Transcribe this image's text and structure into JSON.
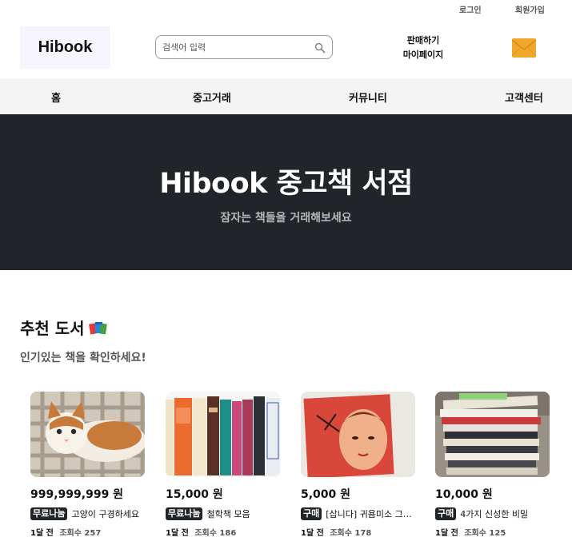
{
  "header": {
    "login": "로그인",
    "signup": "회원가입",
    "logo": "Hibook",
    "search_placeholder": "검색어 입력",
    "sell": "판매하기",
    "mypage": "마이페이지",
    "icons": {
      "search": "magnifier-icon",
      "mail": "envelope-icon"
    }
  },
  "nav": {
    "home": "홈",
    "used": "중고거래",
    "community": "커뮤니티",
    "cs": "고객센터"
  },
  "hero": {
    "title": "Hibook 중고책 서점",
    "subtitle": "잠자는 책들을 거래해보세요"
  },
  "section": {
    "title": "추천 도서",
    "subtitle": "인기있는 책을 확인하세요!"
  },
  "cards": [
    {
      "price": "999,999,999 원",
      "badge": "무료나눔",
      "title": "고양이 구경하세요",
      "time": "1달 전",
      "views": "조회수 257"
    },
    {
      "price": "15,000 원",
      "badge": "무료나눔",
      "title": "철학책 모음",
      "time": "1달 전",
      "views": "조회수 186"
    },
    {
      "price": "5,000 원",
      "badge": "구매",
      "title": "[삽니다] 귀욤미소 그림책",
      "time": "1달 전",
      "views": "조회수 178"
    },
    {
      "price": "10,000 원",
      "badge": "구매",
      "title": "4가지 신성한 비밀",
      "time": "1달 전",
      "views": "조회수 125"
    }
  ],
  "colors": {
    "dark": "#212529",
    "accent": "#f0a82c"
  }
}
